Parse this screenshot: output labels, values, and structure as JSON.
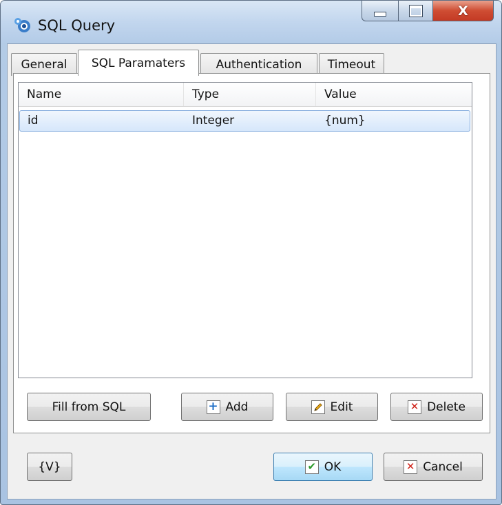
{
  "window": {
    "title": "SQL Query",
    "close_symbol": "X"
  },
  "tabs": [
    {
      "label": "General"
    },
    {
      "label": "SQL Paramaters"
    },
    {
      "label": "Authentication"
    },
    {
      "label": "Timeout"
    }
  ],
  "active_tab": "SQL Paramaters",
  "grid": {
    "columns": [
      "Name",
      "Type",
      "Value"
    ],
    "rows": [
      {
        "name": "id",
        "type": "Integer",
        "value": "{num}",
        "selected": true
      }
    ]
  },
  "actions": {
    "fill": "Fill from SQL",
    "add": "Add",
    "edit": "Edit",
    "delete": "Delete"
  },
  "footer": {
    "variables": "{V}",
    "ok": "OK",
    "cancel": "Cancel"
  },
  "icons": {
    "app": "sql-query-app-icon",
    "add": "blue-plus-icon",
    "edit": "pencil-icon",
    "delete": "red-x-icon",
    "ok": "green-check-icon",
    "cancel": "red-x-icon"
  },
  "colors": {
    "selection_border": "#84acdd",
    "plus_icon": "#1f6fc7",
    "x_icon": "#d0261d",
    "check_icon": "#2a9a2a"
  }
}
